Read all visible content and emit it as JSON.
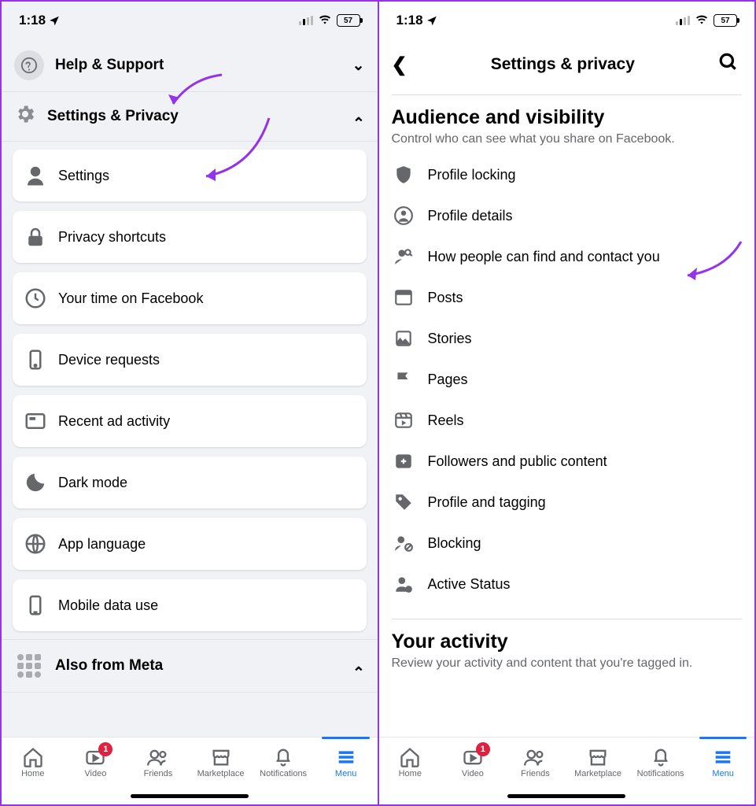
{
  "status": {
    "time": "1:18",
    "battery": "57"
  },
  "screen1": {
    "help_support": "Help & Support",
    "settings_privacy": "Settings & Privacy",
    "cards": {
      "settings": "Settings",
      "privacy_shortcuts": "Privacy shortcuts",
      "your_time": "Your time on Facebook",
      "device_requests": "Device requests",
      "recent_ad": "Recent ad activity",
      "dark_mode": "Dark mode",
      "app_language": "App language",
      "mobile_data": "Mobile data use"
    },
    "also_from_meta": "Also from Meta"
  },
  "screen2": {
    "title": "Settings & privacy",
    "section_title": "Audience and visibility",
    "section_sub": "Control who can see what you share on Facebook.",
    "items": {
      "profile_locking": "Profile locking",
      "profile_details": "Profile details",
      "find_contact": "How people can find and contact you",
      "posts": "Posts",
      "stories": "Stories",
      "pages": "Pages",
      "reels": "Reels",
      "followers": "Followers and public content",
      "profile_tagging": "Profile and tagging",
      "blocking": "Blocking",
      "active_status": "Active Status"
    },
    "activity_title": "Your activity",
    "activity_sub": "Review your activity and content that you're tagged in."
  },
  "tabs": {
    "home": "Home",
    "video": "Video",
    "video_badge": "1",
    "friends": "Friends",
    "marketplace": "Marketplace",
    "notifications": "Notifications",
    "menu": "Menu"
  }
}
